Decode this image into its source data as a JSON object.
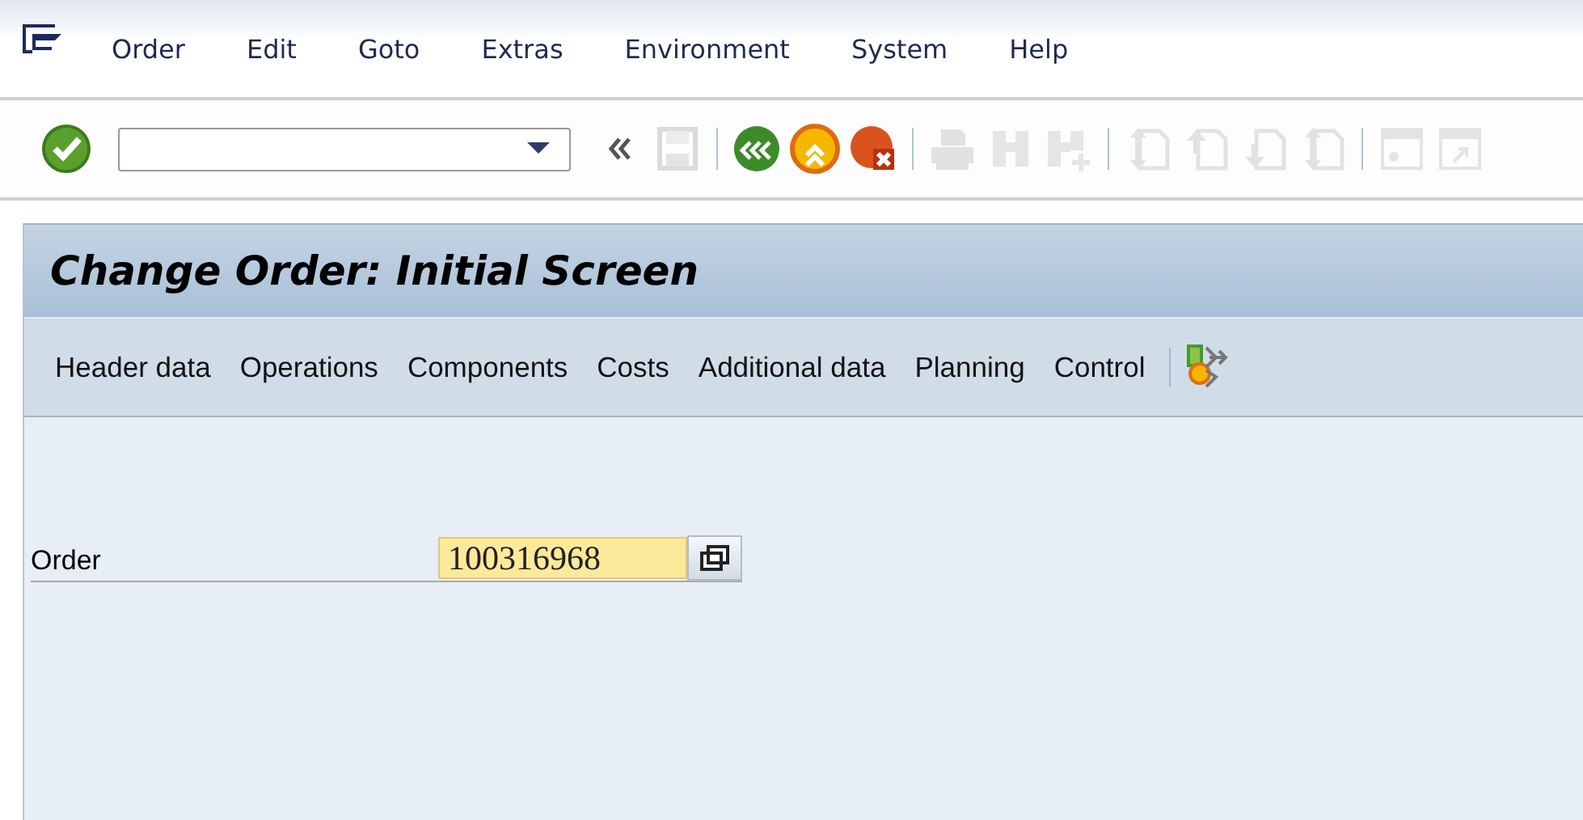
{
  "menu_bar": [
    {
      "label": "Order"
    },
    {
      "label": "Edit"
    },
    {
      "label": "Goto"
    },
    {
      "label": "Extras"
    },
    {
      "label": "Environment"
    },
    {
      "label": "System"
    },
    {
      "label": "Help"
    }
  ],
  "toolbar": [
    {
      "kind": "enter",
      "disabled": false
    },
    {
      "kind": "command_field",
      "disabled": false
    },
    {
      "kind": "collapse",
      "disabled": false
    },
    {
      "kind": "save",
      "disabled": true
    },
    {
      "kind": "separator"
    },
    {
      "kind": "back",
      "disabled": false
    },
    {
      "kind": "exit",
      "disabled": false
    },
    {
      "kind": "cancel",
      "disabled": false
    },
    {
      "kind": "separator"
    },
    {
      "kind": "print",
      "disabled": true
    },
    {
      "kind": "find",
      "disabled": true
    },
    {
      "kind": "find_next",
      "disabled": true
    },
    {
      "kind": "separator"
    },
    {
      "kind": "first_page",
      "disabled": true
    },
    {
      "kind": "previous_page",
      "disabled": true
    },
    {
      "kind": "next_page",
      "disabled": true
    },
    {
      "kind": "last_page",
      "disabled": true
    },
    {
      "kind": "separator"
    },
    {
      "kind": "new_session",
      "disabled": true
    },
    {
      "kind": "shortcut",
      "disabled": true
    }
  ],
  "screen": {
    "title": "Change Order: Initial Screen",
    "application_toolbar": [
      {
        "label": "Header data"
      },
      {
        "label": "Operations"
      },
      {
        "label": "Components"
      },
      {
        "label": "Costs"
      },
      {
        "label": "Additional data"
      },
      {
        "label": "Planning"
      },
      {
        "label": "Control"
      }
    ],
    "fields": [
      {
        "label": "Order",
        "value": "100316968"
      }
    ]
  }
}
